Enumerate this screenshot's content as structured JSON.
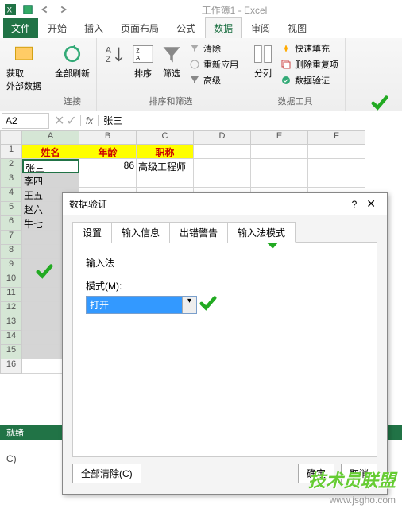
{
  "app": {
    "title": "工作簿1 - Excel"
  },
  "ribbon_tabs": {
    "file": "文件",
    "home": "开始",
    "insert": "插入",
    "page": "页面布局",
    "formulas": "公式",
    "data": "数据",
    "review": "审阅",
    "view": "视图"
  },
  "ribbon": {
    "external": {
      "btn": "获取\n外部数据",
      "group": ""
    },
    "conn": {
      "refresh": "全部刷新",
      "group": "连接"
    },
    "sort": {
      "sort": "排序",
      "filter": "筛选",
      "clear": "清除",
      "reapply": "重新应用",
      "adv": "高级",
      "group": "排序和筛选"
    },
    "tools": {
      "textcol": "分列",
      "flash": "快速填充",
      "dup": "删除重复项",
      "valid": "数据验证",
      "group": "数据工具"
    }
  },
  "name_box": "A2",
  "formula_value": "张三",
  "headers": {
    "name": "姓名",
    "age": "年龄",
    "title": "职称"
  },
  "rows": [
    {
      "a": "张三",
      "b": "86",
      "c": "高级工程师"
    },
    {
      "a": "李四"
    },
    {
      "a": "王五"
    },
    {
      "a": "赵六"
    },
    {
      "a": "牛七"
    }
  ],
  "status": {
    "ready": "就绪"
  },
  "dialog": {
    "title": "数据验证",
    "tabs": {
      "settings": "设置",
      "input": "输入信息",
      "error": "出错警告",
      "ime": "输入法模式"
    },
    "section": "输入法",
    "mode_label": "模式(M):",
    "mode_value": "打开",
    "clear_all": "全部清除(C)",
    "ok": "确定",
    "cancel": "取消"
  },
  "watermark": {
    "text": "技术员联盟",
    "url": "www.jsgho.com"
  },
  "caption": "C)"
}
